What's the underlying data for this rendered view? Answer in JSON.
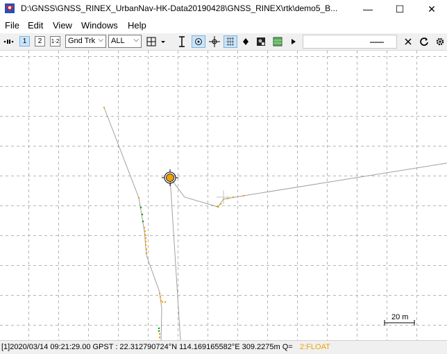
{
  "window": {
    "title": "D:\\GNSS\\GNSS_RINEX_UrbanNav-HK-Data20190428\\GNSS_RINEX\\rtk\\demo5_B...",
    "minimize_glyph": "—",
    "maximize_glyph": "☐",
    "close_glyph": "✕"
  },
  "menu": [
    "File",
    "Edit",
    "View",
    "Windows",
    "Help"
  ],
  "toolbar": {
    "btn1": "1",
    "btn2": "2",
    "btn12": "1·2",
    "plot_type": "Gnd Trk",
    "sat_filter": "ALL"
  },
  "plot": {
    "scale_label": "20 m",
    "colors": {
      "grid": "#b4b4b4",
      "track": "#a0a0a0",
      "float": "#f0a000",
      "fix": "#00a000",
      "marker": "#f0a000"
    }
  },
  "status": {
    "text": "[1]2020/03/14 09:21:29.00 GPST :  22.312790724°N  114.169165582°E  309.2275m  Q=",
    "quality": "2:FLOAT",
    "quality_color": "#f0a000"
  }
}
